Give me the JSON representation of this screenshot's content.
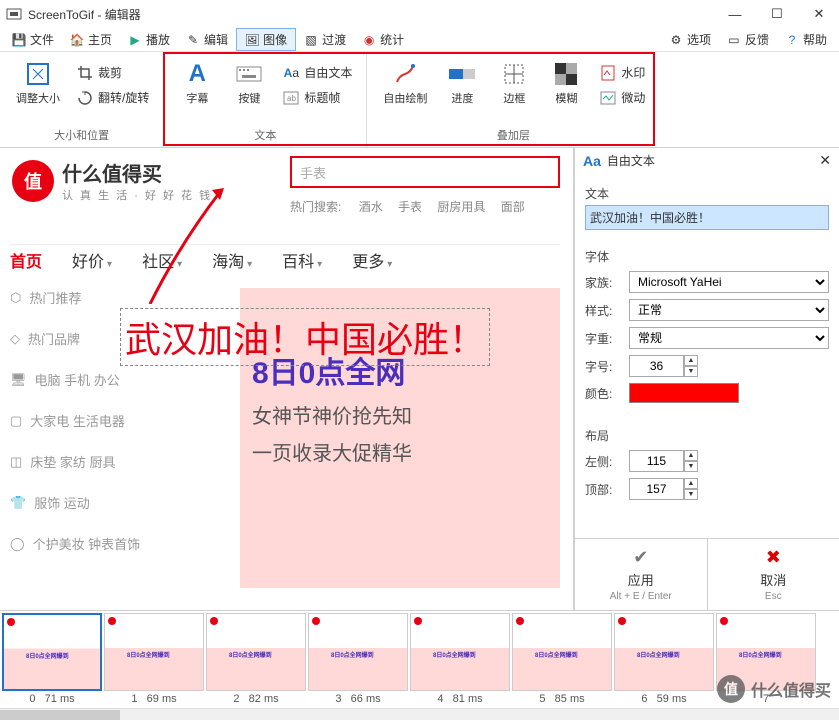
{
  "window": {
    "title": "ScreenToGif - 编辑器"
  },
  "menu": {
    "file": "文件",
    "home": "主页",
    "play": "播放",
    "edit": "编辑",
    "image": "图像",
    "transition": "过渡",
    "stats": "统计",
    "options": "选项",
    "feedback": "反馈",
    "help": "帮助"
  },
  "ribbon": {
    "group_size": {
      "resize": "调整大小",
      "crop": "裁剪",
      "fliprotate": "翻转/旋转",
      "label": "大小和位置"
    },
    "group_text": {
      "caption": "字幕",
      "keys": "按键",
      "freetext": "自由文本",
      "titleframe": "标题帧",
      "label": "文本"
    },
    "group_overlay": {
      "freedraw": "自由绘制",
      "progress": "进度",
      "border": "边框",
      "blur": "模糊",
      "watermark": "水印",
      "cinema": "微动",
      "label": "叠加层"
    }
  },
  "canvas": {
    "logo_main": "什么值得买",
    "logo_sub": "认 真 生 活 · 好 好 花 钱",
    "search_value": "手表",
    "hot_label": "热门搜索:",
    "hot_links": [
      "酒水",
      "手表",
      "厨房用具",
      "面部"
    ],
    "nav": [
      "首页",
      "好价",
      "社区",
      "海淘",
      "百科",
      "更多"
    ],
    "sidebar": [
      "热门推荐",
      "热门品牌",
      "电脑 手机 办公",
      "大家电 生活电器",
      "床垫 家纺 厨具",
      "服饰 运动",
      "个护美妆 钟表首饰"
    ],
    "banner": {
      "bigdate": "8日0点全网",
      "l1": "女神节神价抢先知",
      "l2": "一页收录大促精华"
    },
    "overlay": "武汉加油！中国必胜！"
  },
  "panel": {
    "title": "自由文本",
    "sec_text": "文本",
    "text_value": "武汉加油！中国必胜！",
    "sec_font": "字体",
    "family_lbl": "家族:",
    "family_val": "Microsoft YaHei",
    "style_lbl": "样式:",
    "style_val": "正常",
    "weight_lbl": "字重:",
    "weight_val": "常规",
    "size_lbl": "字号:",
    "size_val": "36",
    "color_lbl": "颜色:",
    "color_val": "#ff0000",
    "sec_layout": "布局",
    "left_lbl": "左侧:",
    "left_val": "115",
    "top_lbl": "顶部:",
    "top_val": "157",
    "apply": "应用",
    "apply_key": "Alt + E / Enter",
    "cancel": "取消",
    "cancel_key": "Esc"
  },
  "timeline": {
    "frames": [
      {
        "idx": "0",
        "ms": "71 ms"
      },
      {
        "idx": "1",
        "ms": "69 ms"
      },
      {
        "idx": "2",
        "ms": "82 ms"
      },
      {
        "idx": "3",
        "ms": "66 ms"
      },
      {
        "idx": "4",
        "ms": "81 ms"
      },
      {
        "idx": "5",
        "ms": "85 ms"
      },
      {
        "idx": "6",
        "ms": "59 ms"
      },
      {
        "idx": "7",
        "ms": ""
      }
    ]
  },
  "watermark": {
    "text": "什么值得买"
  }
}
